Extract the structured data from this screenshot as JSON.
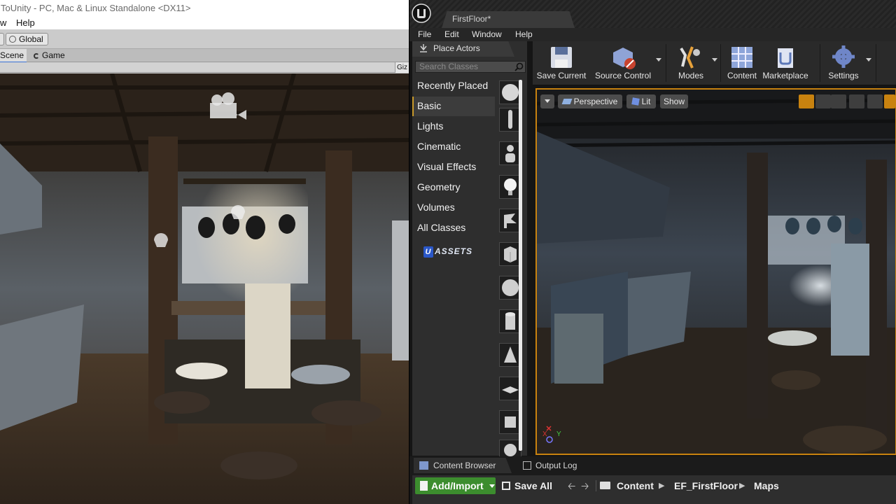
{
  "unity": {
    "window_title": "ToUnity - PC, Mac & Linux Standalone <DX11>",
    "menu": {
      "partial_item": "w",
      "help": "Help"
    },
    "toolbar": {
      "pivot_mode": "Global"
    },
    "tabs": [
      {
        "label": "Scene"
      },
      {
        "label": "Game"
      }
    ],
    "gizmos_label": "Giz"
  },
  "unreal": {
    "level_tab": "FirstFloor*",
    "menu": [
      "File",
      "Edit",
      "Window",
      "Help"
    ],
    "place_actors": {
      "tab_label": "Place Actors",
      "search_placeholder": "Search Classes",
      "categories": [
        "Recently Placed",
        "Basic",
        "Lights",
        "Cinematic",
        "Visual Effects",
        "Geometry",
        "Volumes",
        "All Classes"
      ],
      "active_category": "Basic",
      "uassets_label": "ASSETS",
      "uassets_badge": "U"
    },
    "toolbar": {
      "save_current": "Save Current",
      "source_control": "Source Control",
      "modes": "Modes",
      "content": "Content",
      "marketplace": "Marketplace",
      "settings": "Settings"
    },
    "viewport": {
      "view_mode": "Perspective",
      "lighting": "Lit",
      "show": "Show",
      "axis_x": "X",
      "axis_y": "Y"
    },
    "bottom_tabs": [
      "Content Browser",
      "Output Log"
    ],
    "content_browser": {
      "add_import": "Add/Import",
      "save_all": "Save All",
      "path": [
        "Content",
        "EF_FirstFloor",
        "Maps"
      ]
    }
  },
  "colors": {
    "accent_orange": "#c8820f",
    "add_green": "#3c8d2e",
    "unity_tab_blue": "#3a72d6"
  }
}
